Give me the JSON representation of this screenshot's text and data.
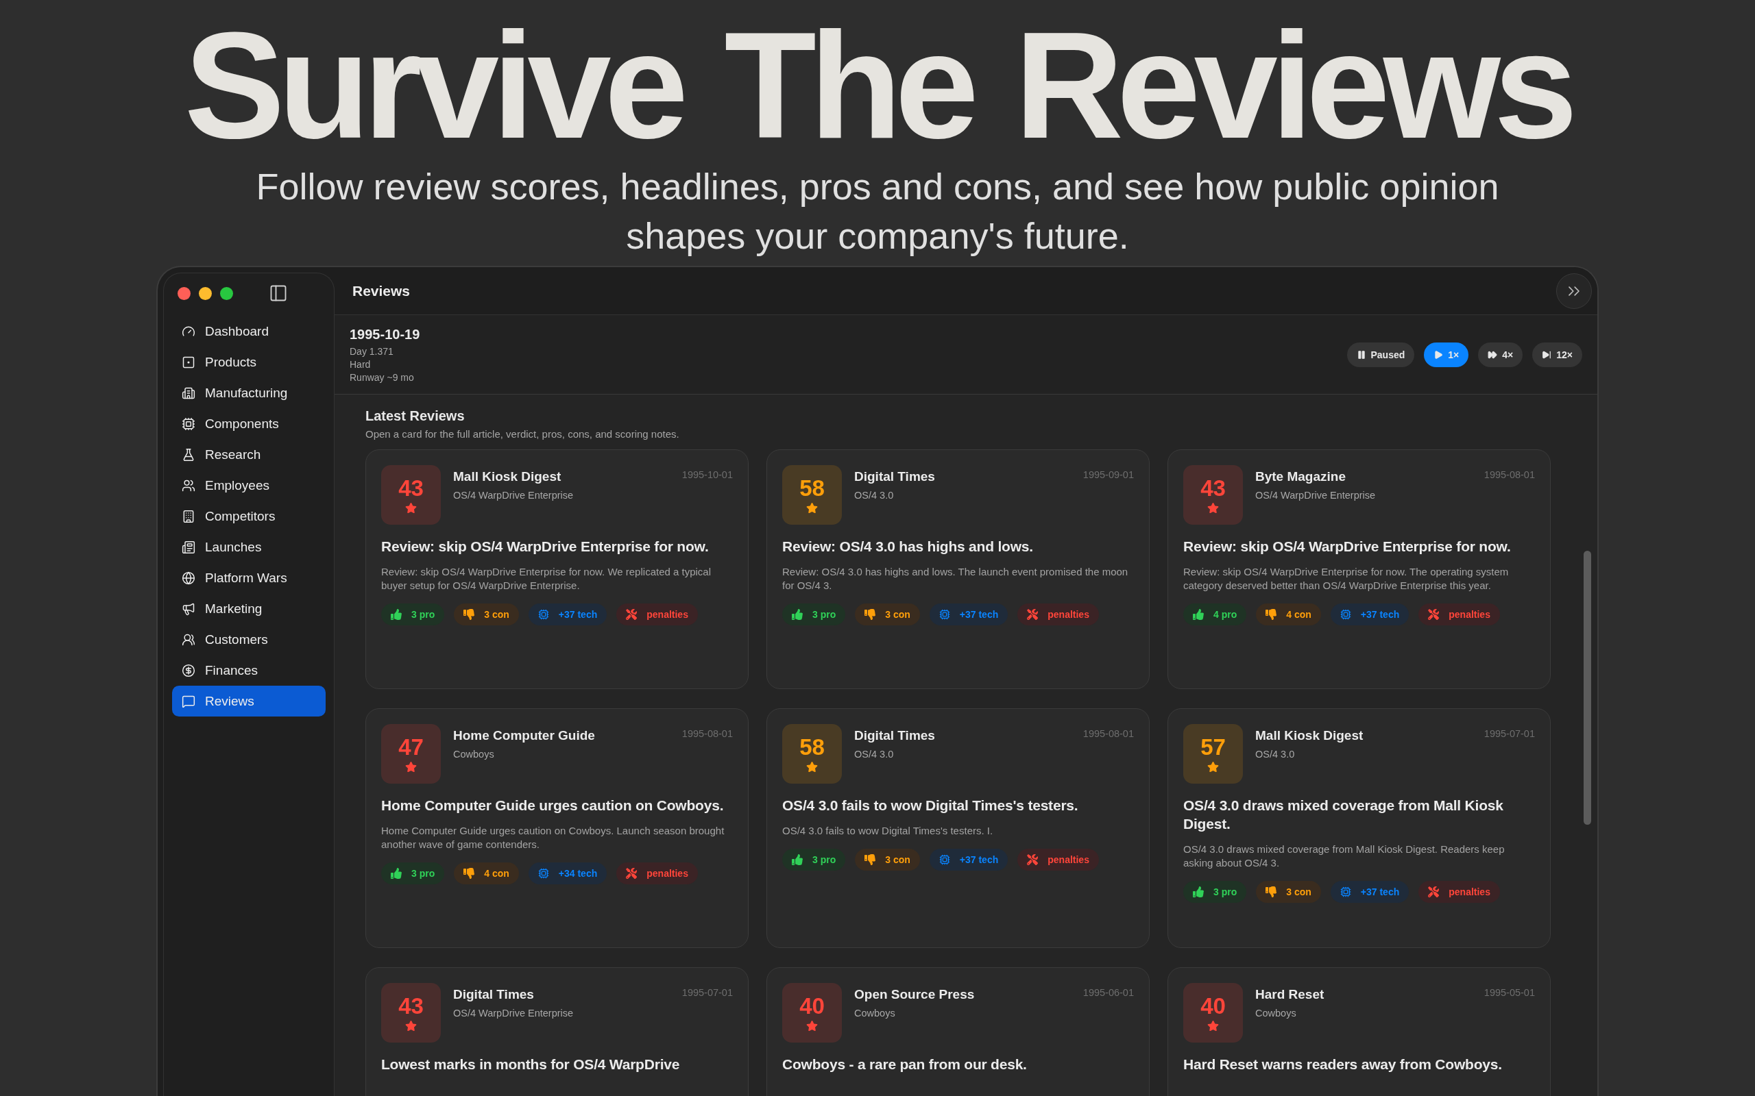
{
  "hero": {
    "title": "Survive The Reviews",
    "subtitle": "Follow review scores, headlines, pros and cons, and see how public opinion shapes your company's future."
  },
  "window": {
    "title": "Reviews"
  },
  "sidebar": {
    "items": [
      {
        "label": "Dashboard",
        "selected": false
      },
      {
        "label": "Products",
        "selected": false
      },
      {
        "label": "Manufacturing",
        "selected": false
      },
      {
        "label": "Components",
        "selected": false
      },
      {
        "label": "Research",
        "selected": false
      },
      {
        "label": "Employees",
        "selected": false
      },
      {
        "label": "Competitors",
        "selected": false
      },
      {
        "label": "Launches",
        "selected": false
      },
      {
        "label": "Platform Wars",
        "selected": false
      },
      {
        "label": "Marketing",
        "selected": false
      },
      {
        "label": "Customers",
        "selected": false
      },
      {
        "label": "Finances",
        "selected": false
      },
      {
        "label": "Reviews",
        "selected": true
      }
    ]
  },
  "status": {
    "date": "1995-10-19",
    "day": "Day 1.371",
    "difficulty": "Hard",
    "runway": "Runway ~9 mo"
  },
  "speed_controls": [
    {
      "label": "Paused",
      "kind": "pause",
      "selected": false
    },
    {
      "label": "1×",
      "kind": "play",
      "selected": true
    },
    {
      "label": "4×",
      "kind": "fast",
      "selected": false
    },
    {
      "label": "12×",
      "kind": "max",
      "selected": false
    }
  ],
  "section": {
    "title": "Latest Reviews",
    "description": "Open a card for the full article, verdict, pros, cons, and scoring notes."
  },
  "reviews": [
    {
      "score": "43",
      "color": "#ff453a",
      "publisher": "Mall Kiosk Digest",
      "product": "OS/4 WarpDrive Enterprise",
      "date": "1995-10-01",
      "headline": "Review: skip OS/4 WarpDrive Enterprise for now.",
      "summary": "Review: skip OS/4 WarpDrive Enterprise for now. We replicated a typical buyer setup for OS/4 WarpDrive Enterprise.",
      "chips": [
        {
          "kind": "pro",
          "label": "3 pro"
        },
        {
          "kind": "con",
          "label": "3 con"
        },
        {
          "kind": "tech",
          "label": "+37 tech"
        },
        {
          "kind": "penalty",
          "label": "penalties"
        }
      ]
    },
    {
      "score": "58",
      "color": "#ff9f0a",
      "publisher": "Digital Times",
      "product": "OS/4 3.0",
      "date": "1995-09-01",
      "headline": "Review: OS/4 3.0 has highs and lows.",
      "summary": "Review: OS/4 3.0 has highs and lows. The launch event promised the moon for OS/4 3.",
      "chips": [
        {
          "kind": "pro",
          "label": "3 pro"
        },
        {
          "kind": "con",
          "label": "3 con"
        },
        {
          "kind": "tech",
          "label": "+37 tech"
        },
        {
          "kind": "penalty",
          "label": "penalties"
        }
      ]
    },
    {
      "score": "43",
      "color": "#ff453a",
      "publisher": "Byte Magazine",
      "product": "OS/4 WarpDrive Enterprise",
      "date": "1995-08-01",
      "headline": "Review: skip OS/4 WarpDrive Enterprise for now.",
      "summary": "Review: skip OS/4 WarpDrive Enterprise for now. The operating system category deserved better than OS/4 WarpDrive Enterprise this year.",
      "chips": [
        {
          "kind": "pro",
          "label": "4 pro"
        },
        {
          "kind": "con",
          "label": "4 con"
        },
        {
          "kind": "tech",
          "label": "+37 tech"
        },
        {
          "kind": "penalty",
          "label": "penalties"
        }
      ]
    },
    {
      "score": "47",
      "color": "#ff453a",
      "publisher": "Home Computer Guide",
      "product": "Cowboys",
      "date": "1995-08-01",
      "headline": "Home Computer Guide urges caution on Cowboys.",
      "summary": "Home Computer Guide urges caution on Cowboys. Launch season brought another wave of game contenders.",
      "chips": [
        {
          "kind": "pro",
          "label": "3 pro"
        },
        {
          "kind": "con",
          "label": "4 con"
        },
        {
          "kind": "tech",
          "label": "+34 tech"
        },
        {
          "kind": "penalty",
          "label": "penalties"
        }
      ]
    },
    {
      "score": "58",
      "color": "#ff9f0a",
      "publisher": "Digital Times",
      "product": "OS/4 3.0",
      "date": "1995-08-01",
      "headline": "OS/4 3.0 fails to wow Digital Times's testers.",
      "summary": "OS/4 3.0 fails to wow Digital Times's testers. I.",
      "chips": [
        {
          "kind": "pro",
          "label": "3 pro"
        },
        {
          "kind": "con",
          "label": "3 con"
        },
        {
          "kind": "tech",
          "label": "+37 tech"
        },
        {
          "kind": "penalty",
          "label": "penalties"
        }
      ]
    },
    {
      "score": "57",
      "color": "#ff9f0a",
      "publisher": "Mall Kiosk Digest",
      "product": "OS/4 3.0",
      "date": "1995-07-01",
      "headline": "OS/4 3.0 draws mixed coverage from Mall Kiosk Digest.",
      "summary": "OS/4 3.0 draws mixed coverage from Mall Kiosk Digest. Readers keep asking about OS/4 3.",
      "chips": [
        {
          "kind": "pro",
          "label": "3 pro"
        },
        {
          "kind": "con",
          "label": "3 con"
        },
        {
          "kind": "tech",
          "label": "+37 tech"
        },
        {
          "kind": "penalty",
          "label": "penalties"
        }
      ]
    },
    {
      "score": "43",
      "color": "#ff453a",
      "publisher": "Digital Times",
      "product": "OS/4 WarpDrive Enterprise",
      "date": "1995-07-01",
      "headline": "Lowest marks in months for OS/4 WarpDrive"
    },
    {
      "score": "40",
      "color": "#ff453a",
      "publisher": "Open Source Press",
      "product": "Cowboys",
      "date": "1995-06-01",
      "headline": "Cowboys - a rare pan from our desk."
    },
    {
      "score": "40",
      "color": "#ff453a",
      "publisher": "Hard Reset",
      "product": "Cowboys",
      "date": "1995-05-01",
      "headline": "Hard Reset warns readers away from Cowboys."
    }
  ]
}
